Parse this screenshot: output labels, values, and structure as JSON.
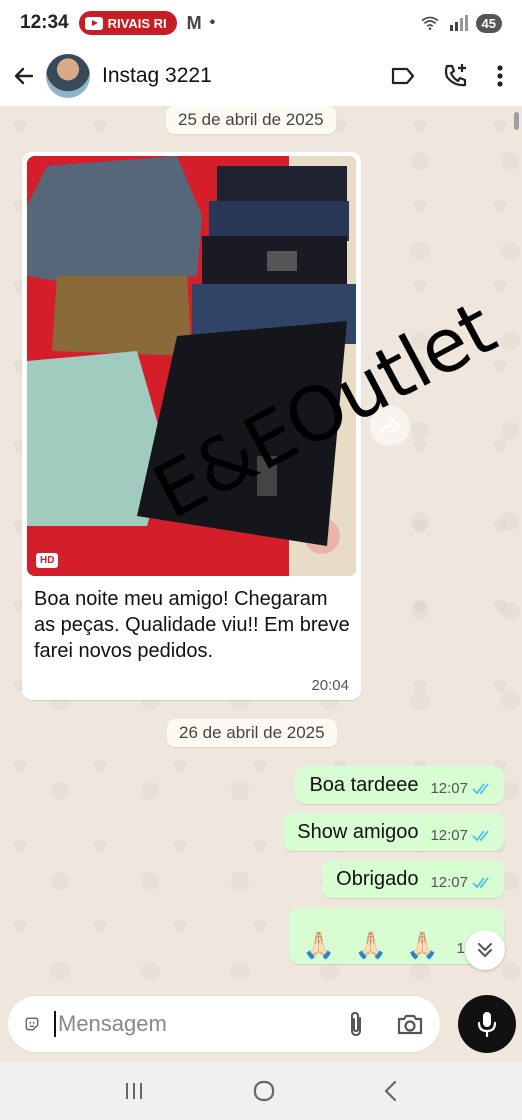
{
  "status_bar": {
    "time": "12:34",
    "youtube_label": "RIVAIS RI",
    "notification_letter": "M",
    "dot": "•",
    "battery": "45"
  },
  "header": {
    "contact_name": "Instag 3221"
  },
  "chat": {
    "date_1": "25 de abril de 2025",
    "incoming": {
      "text": "Boa noite meu amigo! Chegaram as peças. Qualidade viu!! Em breve farei novos pedidos.",
      "time": "20:04",
      "hd_label": "HD",
      "watermark": "E&EOutlet"
    },
    "date_2": "26 de abril de 2025",
    "outgoing": [
      {
        "text": "Boa tardeee",
        "time": "12:07"
      },
      {
        "text": "Show amigoo",
        "time": "12:07"
      },
      {
        "text": "Obrigado",
        "time": "12:07"
      },
      {
        "text": "🙏🏻 🙏🏻 🙏🏻",
        "time": "12:07"
      }
    ]
  },
  "composer": {
    "placeholder": "Mensagem"
  },
  "colors": {
    "outgoing_bubble": "#d8fdd2",
    "incoming_bubble": "#ffffff",
    "chat_background": "#efe7dd",
    "read_ticks": "#53bdeb",
    "youtube_red": "#c81d25"
  },
  "icons": [
    "back-arrow-icon",
    "label-icon",
    "add-call-icon",
    "more-vert-icon",
    "forward-icon",
    "sticker-icon",
    "attach-icon",
    "camera-icon",
    "mic-icon",
    "chevron-double-down-icon",
    "wifi-icon",
    "signal-icon"
  ]
}
